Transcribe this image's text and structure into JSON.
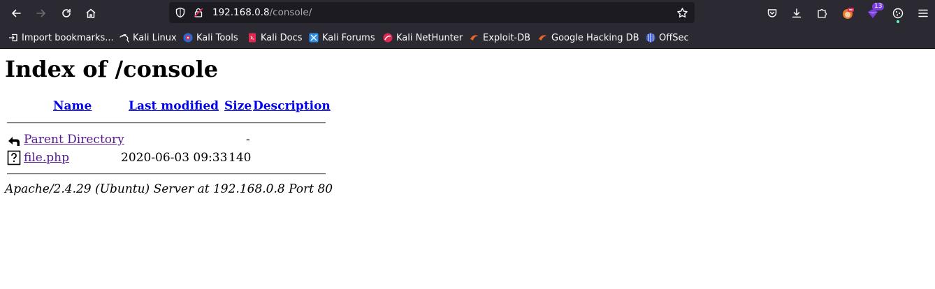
{
  "browser": {
    "url_host": "192.168.0.8",
    "url_path": "/console/",
    "extensions_badge": "13",
    "bookmarks": [
      {
        "label": "Import bookmarks...",
        "icon": "import-icon"
      },
      {
        "label": "Kali Linux",
        "icon": "kali-dragon-icon"
      },
      {
        "label": "Kali Tools",
        "icon": "kali-tools-icon"
      },
      {
        "label": "Kali Docs",
        "icon": "kali-docs-icon"
      },
      {
        "label": "Kali Forums",
        "icon": "kali-forums-icon"
      },
      {
        "label": "Kali NetHunter",
        "icon": "kali-nethunter-icon"
      },
      {
        "label": "Exploit-DB",
        "icon": "exploit-db-icon"
      },
      {
        "label": "Google Hacking DB",
        "icon": "ghdb-icon"
      },
      {
        "label": "OffSec",
        "icon": "offsec-icon"
      }
    ]
  },
  "page": {
    "title": "Index of /console",
    "columns": {
      "name": "Name",
      "last_modified": "Last modified",
      "size": "Size",
      "description": "Description"
    },
    "rows": [
      {
        "name": "Parent Directory",
        "last_modified": "",
        "size": "-",
        "description": "",
        "icon": "back-arrow-icon"
      },
      {
        "name": "file.php",
        "last_modified": "2020-06-03 09:33",
        "size": "140",
        "description": "",
        "icon": "unknown-file-icon"
      }
    ],
    "footer": "Apache/2.4.29 (Ubuntu) Server at 192.168.0.8 Port 80"
  },
  "colors": {
    "chrome_bg": "#2b2a33",
    "urlbar_bg": "#1c1b22",
    "link": "#0000ee",
    "visited_link": "#551a8b"
  }
}
